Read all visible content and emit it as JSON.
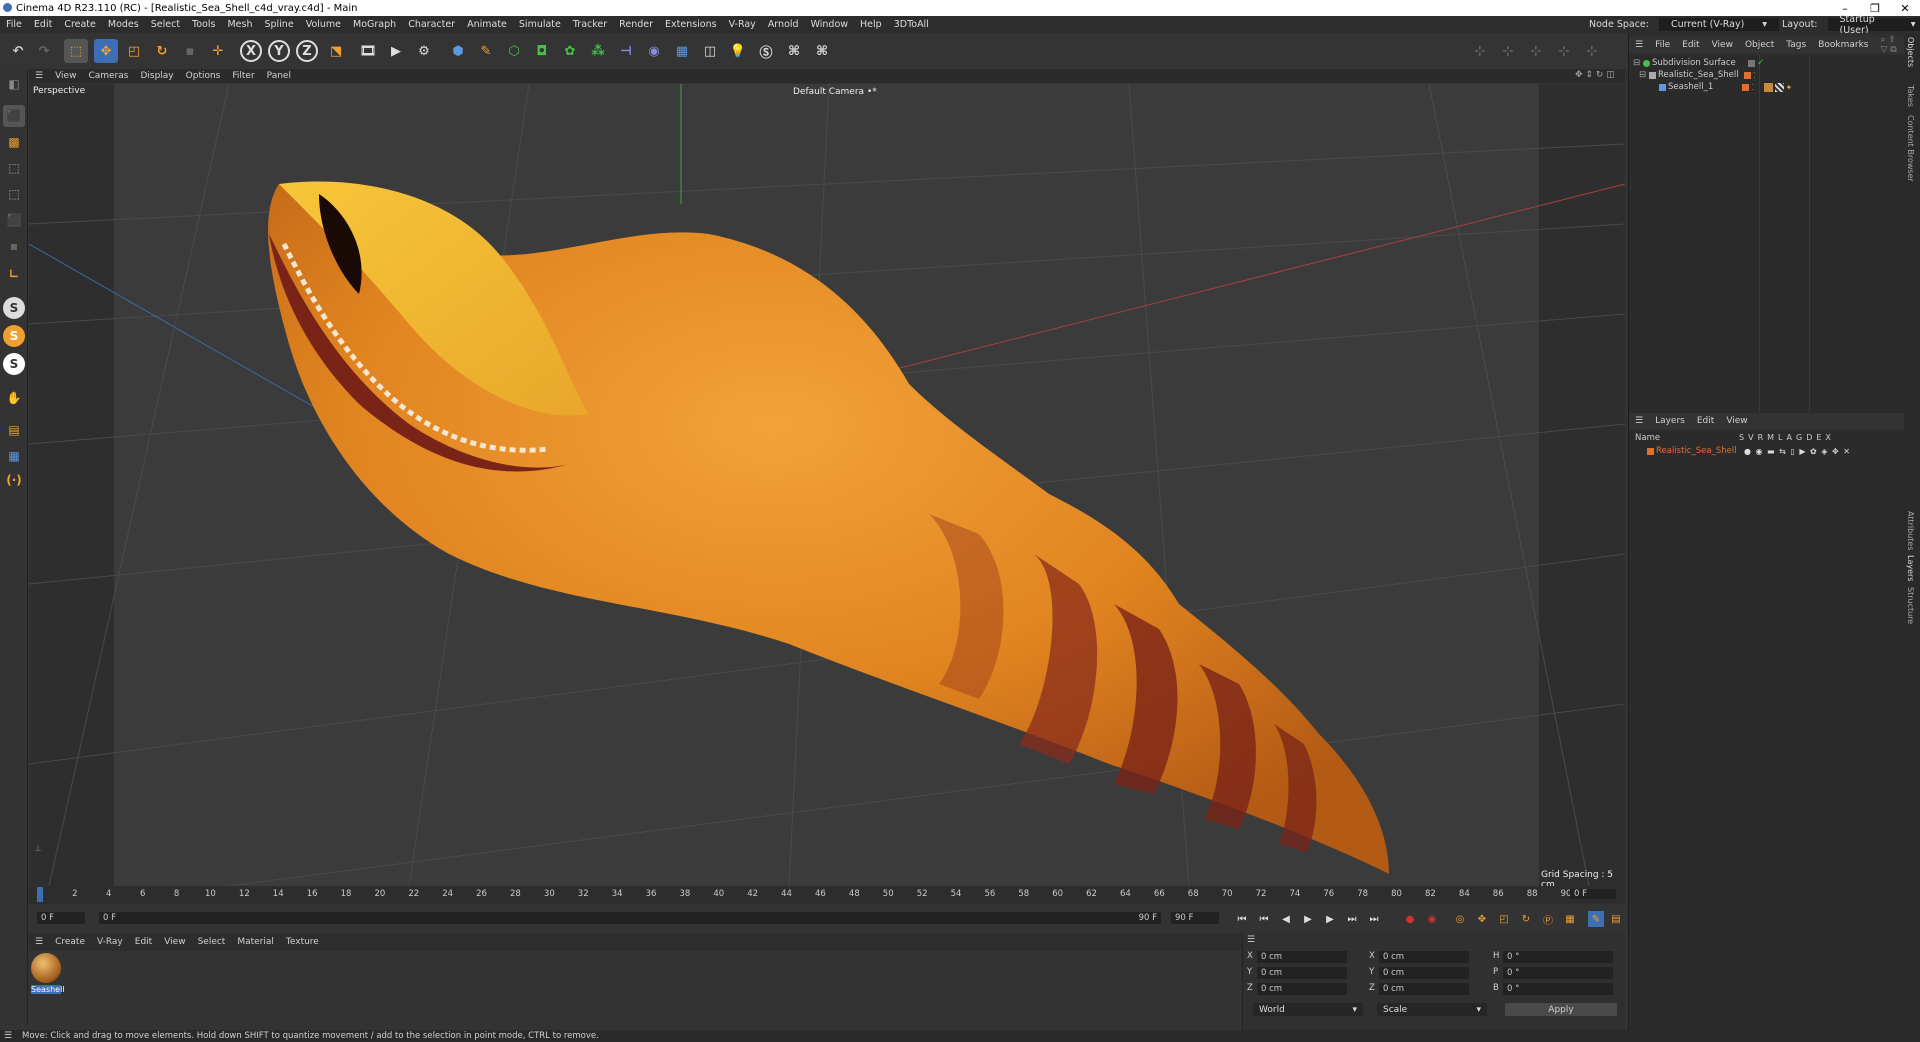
{
  "window": {
    "title": "Cinema 4D R23.110 (RC) - [Realistic_Sea_Shell_c4d_vray.c4d] - Main"
  },
  "menubar": {
    "items": [
      "File",
      "Edit",
      "Create",
      "Modes",
      "Select",
      "Tools",
      "Mesh",
      "Spline",
      "Volume",
      "MoGraph",
      "Character",
      "Animate",
      "Simulate",
      "Tracker",
      "Render",
      "Extensions",
      "V-Ray",
      "Arnold",
      "Window",
      "Help",
      "3DToAll"
    ],
    "node_space_label": "Node Space:",
    "node_space_value": "Current (V-Ray)",
    "layout_label": "Layout:",
    "layout_value": "Startup (User)"
  },
  "toolbar": {
    "axis_x": "X",
    "axis_y": "Y",
    "axis_z": "Z"
  },
  "viewport": {
    "menu": [
      "View",
      "Cameras",
      "Display",
      "Options",
      "Filter",
      "Panel"
    ],
    "label": "Perspective",
    "camera": "Default Camera",
    "camera_suffix": "•*",
    "grid_spacing": "Grid Spacing : 5 cm"
  },
  "timeline": {
    "ticks": [
      "0",
      "2",
      "4",
      "6",
      "8",
      "10",
      "12",
      "14",
      "16",
      "18",
      "20",
      "22",
      "24",
      "26",
      "28",
      "30",
      "32",
      "34",
      "36",
      "38",
      "40",
      "42",
      "44",
      "46",
      "48",
      "50",
      "52",
      "54",
      "56",
      "58",
      "60",
      "62",
      "64",
      "66",
      "68",
      "70",
      "72",
      "74",
      "76",
      "78",
      "80",
      "82",
      "84",
      "86",
      "88",
      "90"
    ],
    "current_frame_right": "0 F",
    "start_field": "0 F",
    "min_field": "0 F",
    "end_field": "90 F",
    "max_field": "90 F"
  },
  "material_manager": {
    "menu": [
      "Create",
      "V-Ray",
      "Edit",
      "View",
      "Select",
      "Material",
      "Texture"
    ],
    "materials": [
      {
        "name": "Seashell"
      }
    ]
  },
  "coordinates": {
    "rows": [
      {
        "pos_label": "X",
        "pos_val": "0 cm",
        "size_label": "X",
        "size_val": "0 cm",
        "rot_label": "H",
        "rot_val": "0 °"
      },
      {
        "pos_label": "Y",
        "pos_val": "0 cm",
        "size_label": "Y",
        "size_val": "0 cm",
        "rot_label": "P",
        "rot_val": "0 °"
      },
      {
        "pos_label": "Z",
        "pos_val": "0 cm",
        "size_label": "Z",
        "size_val": "0 cm",
        "rot_label": "B",
        "rot_val": "0 °"
      }
    ],
    "mode_1": "World",
    "mode_2": "Scale",
    "apply": "Apply"
  },
  "objects_panel": {
    "menu": [
      "File",
      "Edit",
      "View",
      "Object",
      "Tags",
      "Bookmarks"
    ],
    "objects": [
      {
        "name": "Subdivision Surface",
        "color": "#5fbf5f"
      },
      {
        "name": "Realistic_Sea_Shell",
        "color": "#e07030"
      },
      {
        "name": "Seashell_1",
        "color": "#e07030"
      }
    ]
  },
  "layers_panel": {
    "menu": [
      "Layers",
      "Edit",
      "View"
    ],
    "header_name": "Name",
    "header_flags": [
      "S",
      "V",
      "R",
      "M",
      "L",
      "A",
      "G",
      "D",
      "E",
      "X"
    ],
    "layers": [
      {
        "name": "Realistic_Sea_Shell",
        "color": "#e07030"
      }
    ]
  },
  "side_tabs": [
    "Objects",
    "Takes",
    "Content Browser",
    "Attributes",
    "Layers",
    "Structure"
  ],
  "status": {
    "text": "Move: Click and drag to move elements. Hold down SHIFT to quantize movement / add to the selection in point mode, CTRL to remove."
  },
  "colors": {
    "accent_blue": "#3d6fb5",
    "shell_orange": "#e89020",
    "shell_band": "#8a2c1c"
  }
}
